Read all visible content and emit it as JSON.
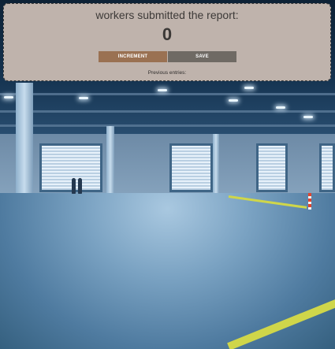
{
  "panel": {
    "title": "workers submitted the report:",
    "count": "0",
    "increment_label": "INCREMENT",
    "save_label": "SAVE",
    "previous_entries_label": "Previous entries:"
  },
  "colors": {
    "panel_bg": "#bfb3ac",
    "increment_button": "#9a7152",
    "save_button": "#6f6a64"
  },
  "background": {
    "description_icon": "warehouse-photo"
  }
}
